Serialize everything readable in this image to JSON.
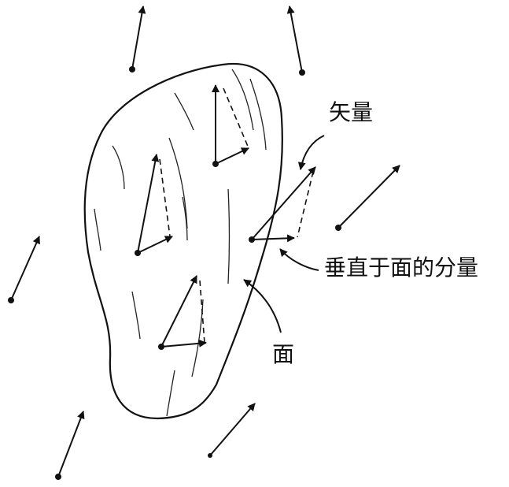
{
  "labels": {
    "vector": "矢量",
    "normal_component": "垂直于面的分量",
    "surface": "面"
  },
  "colors": {
    "ink": "#111111",
    "background": "#ffffff"
  }
}
